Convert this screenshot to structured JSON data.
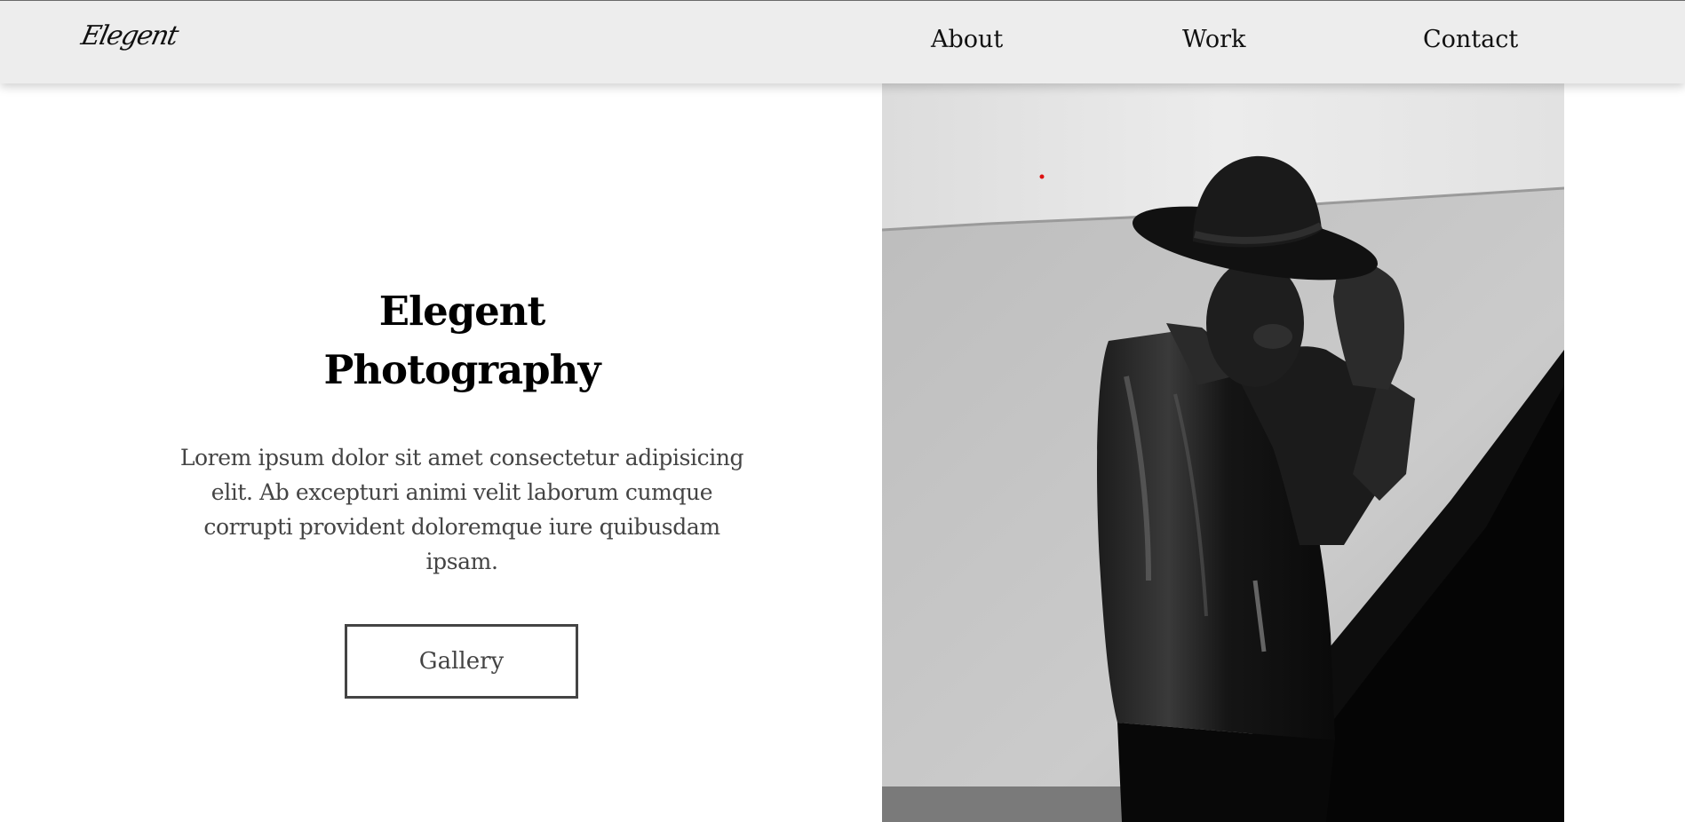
{
  "brand": {
    "logo_text": "Elegent"
  },
  "nav": {
    "items": [
      {
        "label": "About"
      },
      {
        "label": "Work"
      },
      {
        "label": "Contact"
      }
    ]
  },
  "hero": {
    "title_line1": "Elegent",
    "title_line2": "Photography",
    "description": "Lorem ipsum dolor sit amet consectetur adipisicing elit. Ab excepturi animi velit laborum cumque corrupti provident doloremque iure quibusdam ipsam.",
    "button_label": "Gallery"
  },
  "image": {
    "subject": "man-in-hat-and-leather-jacket-photo"
  },
  "colors": {
    "navbar_bg": "#ededed",
    "text_dark": "#000000",
    "text_muted": "#444444",
    "button_border": "#444444"
  }
}
